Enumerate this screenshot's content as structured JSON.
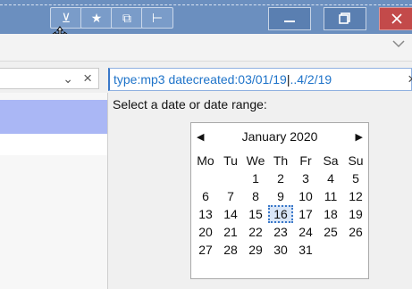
{
  "toolbar": {
    "quick_access": [
      {
        "name": "properties-icon",
        "glyph": "⊻"
      },
      {
        "name": "pin-star-icon",
        "glyph": "★"
      },
      {
        "name": "new-folder-icon",
        "glyph": "⧉"
      },
      {
        "name": "rename-icon",
        "glyph": "⊢"
      }
    ],
    "window_buttons": [
      "minimize-icon",
      "maximize-icon",
      "close-icon"
    ]
  },
  "left_bar": {
    "chevron": "⌄",
    "clear": "×"
  },
  "search": {
    "value_part1": "type:mp3 datecreated:03/01/19",
    "value_part2": "..4/2/19",
    "clear": "×"
  },
  "popup": {
    "prompt": "Select a date or date range:"
  },
  "calendar": {
    "title": "January 2020",
    "prev": "◀",
    "next": "▶",
    "weekdays": [
      "Mo",
      "Tu",
      "We",
      "Th",
      "Fr",
      "Sa",
      "Su"
    ],
    "weeks": [
      [
        "",
        "",
        "1",
        "2",
        "3",
        "4",
        "5"
      ],
      [
        "6",
        "7",
        "8",
        "9",
        "10",
        "11",
        "12"
      ],
      [
        "13",
        "14",
        "15",
        "16",
        "17",
        "18",
        "19"
      ],
      [
        "20",
        "21",
        "22",
        "23",
        "24",
        "25",
        "26"
      ],
      [
        "27",
        "28",
        "29",
        "30",
        "31",
        "",
        ""
      ]
    ],
    "selected_day": "16"
  },
  "colors": {
    "titlebar": "#6b8fbf",
    "accent": "#1e73c9",
    "selection": "#aab7f5"
  }
}
